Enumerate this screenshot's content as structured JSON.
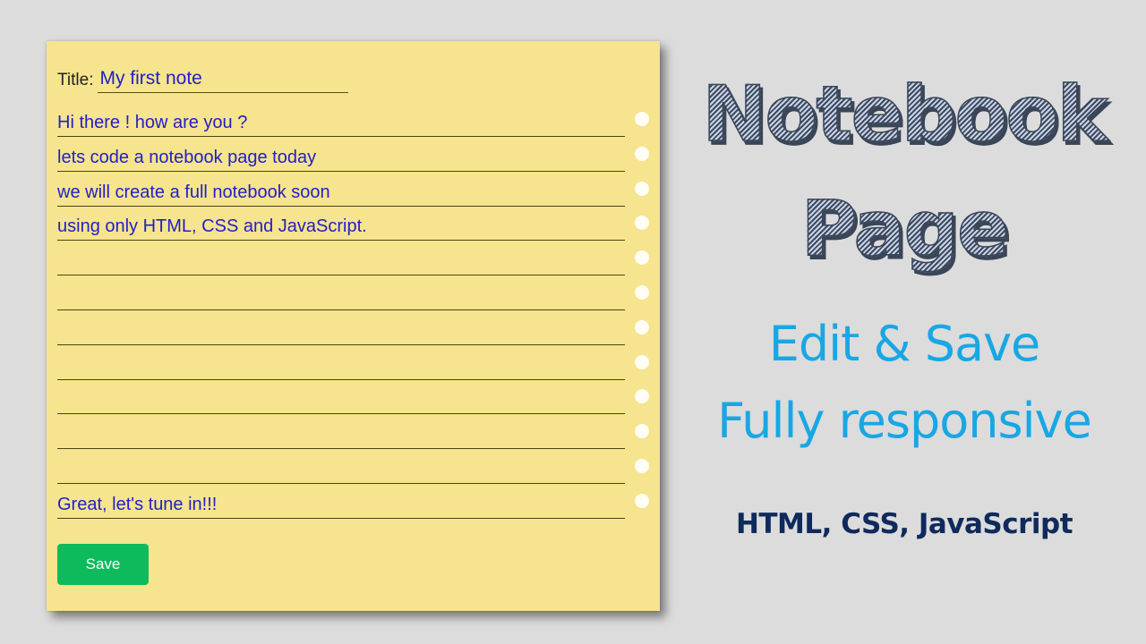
{
  "notebook": {
    "title_label": "Title:",
    "title_value": "My first note",
    "lines": [
      "Hi there ! how are you ?",
      "lets code a notebook page today",
      "we will create a full notebook soon",
      "using only HTML, CSS and JavaScript.",
      "",
      "",
      "",
      "",
      "",
      "",
      "",
      "Great, let's tune in!!!"
    ],
    "save_label": "Save"
  },
  "promo": {
    "headline_line1": "Notebook",
    "headline_line2": "Page",
    "feature_line1": "Edit & Save",
    "feature_line2": "Fully responsive",
    "tech_line": "HTML, CSS, JavaScript"
  },
  "colors": {
    "page_background": "#f6e48e",
    "note_text": "#2320c8",
    "save_button": "#0ebb5c",
    "feature_text": "#19a7e4",
    "tech_text": "#0f2a5c"
  }
}
